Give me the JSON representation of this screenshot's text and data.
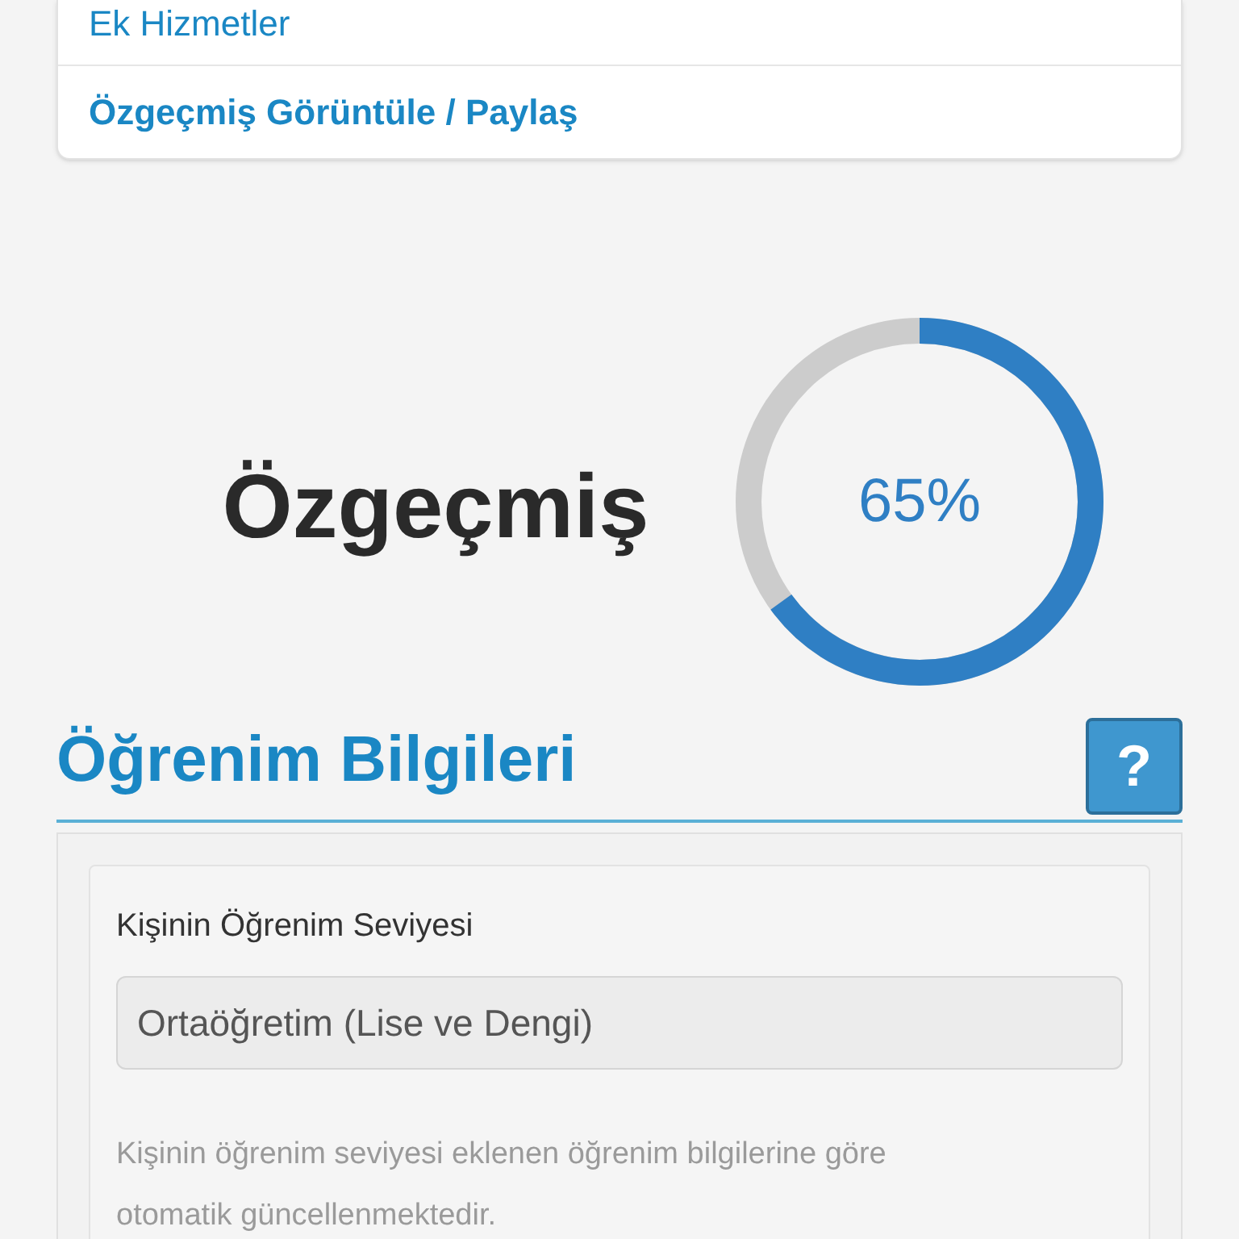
{
  "menu": [
    {
      "label": "Ek Hizmetler",
      "bold": false
    },
    {
      "label": "Özgeçmiş Görüntüle / Paylaş",
      "bold": true
    }
  ],
  "resume": {
    "title": "Özgeçmiş",
    "completion": {
      "level": 0.65,
      "reading": "65%"
    }
  },
  "section": {
    "title": "Öğrenim Bilgileri",
    "help": "?"
  },
  "field": {
    "label": "Kişinin Öğrenim Seviyesi",
    "value": "Ortaöğretim (Lise ve Dengi)",
    "disabled": true,
    "hint": "Kişinin öğrenim seviyesi eklenen öğrenim bilgilerine göre otomatik güncellenmektedir."
  }
}
